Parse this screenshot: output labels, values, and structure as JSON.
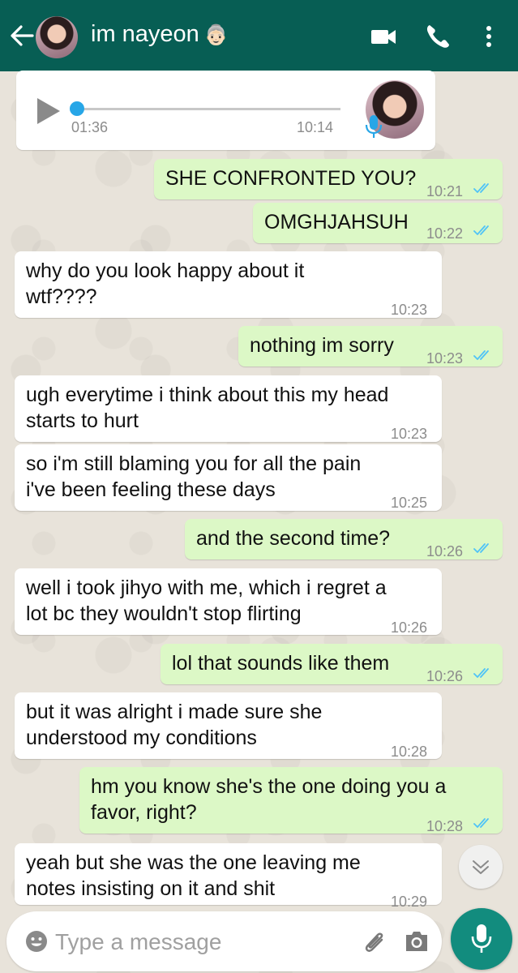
{
  "header": {
    "contact_name": "im nayeon",
    "contact_emoji": "👵🏻",
    "icons": [
      "back-arrow-icon",
      "avatar",
      "video-call-icon",
      "phone-icon",
      "more-options-icon"
    ]
  },
  "voice_message": {
    "duration": "01:36",
    "time": "10:14",
    "progress": 0.0
  },
  "messages": [
    {
      "dir": "out",
      "lines": [
        "SHE CONFRONTED YOU?"
      ],
      "time": "10:21",
      "read": true
    },
    {
      "dir": "out",
      "lines": [
        "OMGHJAHSUH"
      ],
      "time": "10:22",
      "read": true
    },
    {
      "dir": "in",
      "lines": [
        "why do you look happy about it",
        "wtf????"
      ],
      "time": "10:23"
    },
    {
      "dir": "out",
      "lines": [
        "nothing im sorry"
      ],
      "time": "10:23",
      "read": true
    },
    {
      "dir": "in",
      "lines": [
        "ugh everytime i think about this my head",
        "starts to hurt"
      ],
      "time": "10:23"
    },
    {
      "dir": "in",
      "lines": [
        "so i'm still blaming you for all the pain",
        "i've been feeling these days"
      ],
      "time": "10:25"
    },
    {
      "dir": "out",
      "lines": [
        "and the second time?"
      ],
      "time": "10:26",
      "read": true
    },
    {
      "dir": "in",
      "lines": [
        "well i took jihyo with me, which i regret a",
        "lot bc they wouldn't stop flirting"
      ],
      "time": "10:26"
    },
    {
      "dir": "out",
      "lines": [
        "lol that sounds like them"
      ],
      "time": "10:26",
      "read": true
    },
    {
      "dir": "in",
      "lines": [
        "but it was alright i made sure she",
        "understood my conditions"
      ],
      "time": "10:28"
    },
    {
      "dir": "out",
      "lines": [
        "hm you know she's the one doing you a",
        "favor, right?"
      ],
      "time": "10:28",
      "read": true
    },
    {
      "dir": "in",
      "lines": [
        "yeah but she was the one leaving me",
        "notes insisting on it and shit"
      ],
      "time": "10:29"
    }
  ],
  "input": {
    "placeholder": "Type a message"
  },
  "colors": {
    "header": "#075e54",
    "outgoing_bubble": "#dcf8c6",
    "incoming_bubble": "#ffffff",
    "read_ticks": "#4fc3f7",
    "mic_button": "#128c7e"
  }
}
